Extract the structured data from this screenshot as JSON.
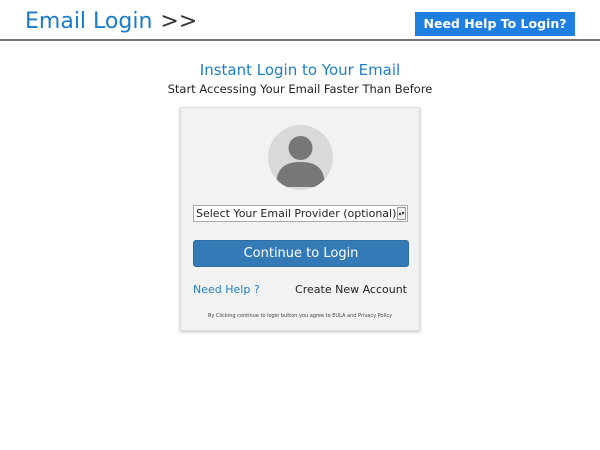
{
  "header": {
    "brand": "Email Login",
    "brand_arrows": ">>",
    "help_button": "Need Help To Login?"
  },
  "hero": {
    "title": "Instant Login to Your Email",
    "subtitle": "Start Accessing Your Email Faster Than Before"
  },
  "card": {
    "avatar_icon": "user-avatar-icon",
    "provider_select": {
      "selected": "Select Your Email Provider (optional)"
    },
    "continue_button": "Continue to Login",
    "need_help_link": "Need Help ?",
    "create_account_link": "Create New Account",
    "disclaimer": "By Clicking continue to login button you agree to EULA and Privacy Policy"
  },
  "colors": {
    "brand": "#1a7bc8",
    "help_button_bg": "#1e7fe0",
    "continue_button_bg": "#337ab7",
    "link": "#1f7fc4",
    "card_bg": "#f2f2f2",
    "avatar_bg": "#d9d9d9",
    "avatar_silhouette": "#777777"
  }
}
